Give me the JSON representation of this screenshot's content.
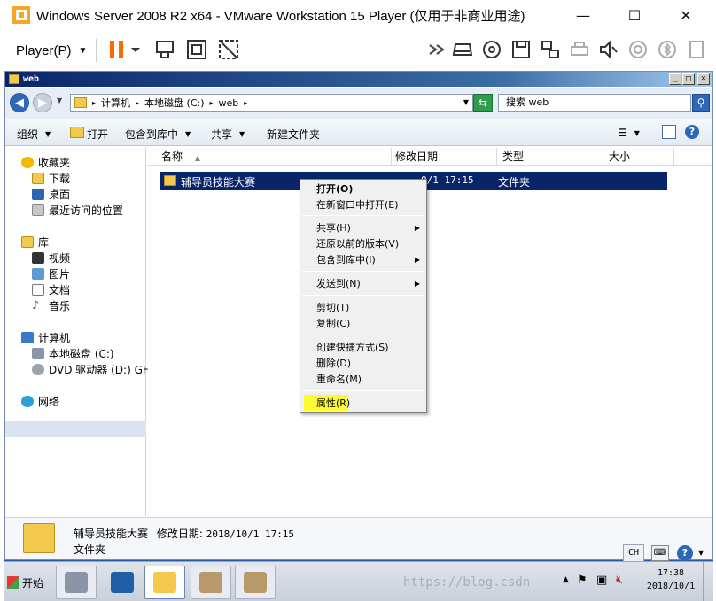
{
  "vm": {
    "title": "Windows Server 2008 R2 x64 - VMware Workstation 15 Player (仅用于非商业用途)",
    "minimize": "—",
    "maximize": "☐",
    "close": "✕",
    "player_menu": "Player(P)",
    "pause_color": "#ff6a00"
  },
  "explorer": {
    "title": "web",
    "breadcrumb": [
      "计算机",
      "本地磁盘 (C:)",
      "web"
    ],
    "search_placeholder": "搜索 web",
    "commands": {
      "organize": "组织",
      "open": "打开",
      "include_in_library": "包含到库中",
      "share": "共享",
      "new_folder": "新建文件夹"
    },
    "nav": {
      "favorites": "收藏夹",
      "downloads": "下载",
      "desktop": "桌面",
      "recent": "最近访问的位置",
      "libraries": "库",
      "videos": "视频",
      "pictures": "图片",
      "documents": "文档",
      "music": "音乐",
      "computer": "计算机",
      "local_disk": "本地磁盘 (C:)",
      "dvd_drive": "DVD 驱动器 (D:) GF",
      "network": "网络"
    },
    "columns": [
      "名称",
      "修改日期",
      "类型",
      "大小"
    ],
    "files": [
      {
        "name": "辅导员技能大赛",
        "date": "0/1 17:15",
        "type": "文件夹"
      }
    ],
    "details": {
      "name": "辅导员技能大赛",
      "modified_label": "修改日期:",
      "modified_value": "2018/10/1 17:15",
      "type": "文件夹"
    }
  },
  "context_menu": {
    "items": [
      "打开(O)",
      "在新窗口中打开(E)",
      "共享(H)",
      "还原以前的版本(V)",
      "包含到库中(I)",
      "发送到(N)",
      "剪切(T)",
      "复制(C)",
      "创建快捷方式(S)",
      "删除(D)",
      "重命名(M)",
      "属性(R)"
    ],
    "highlight_color": "#fdfa34"
  },
  "taskbar": {
    "start": "开始",
    "lang": "CH",
    "time": "17:38",
    "date": "2018/10/1"
  },
  "watermark": "https://blog.csdn"
}
